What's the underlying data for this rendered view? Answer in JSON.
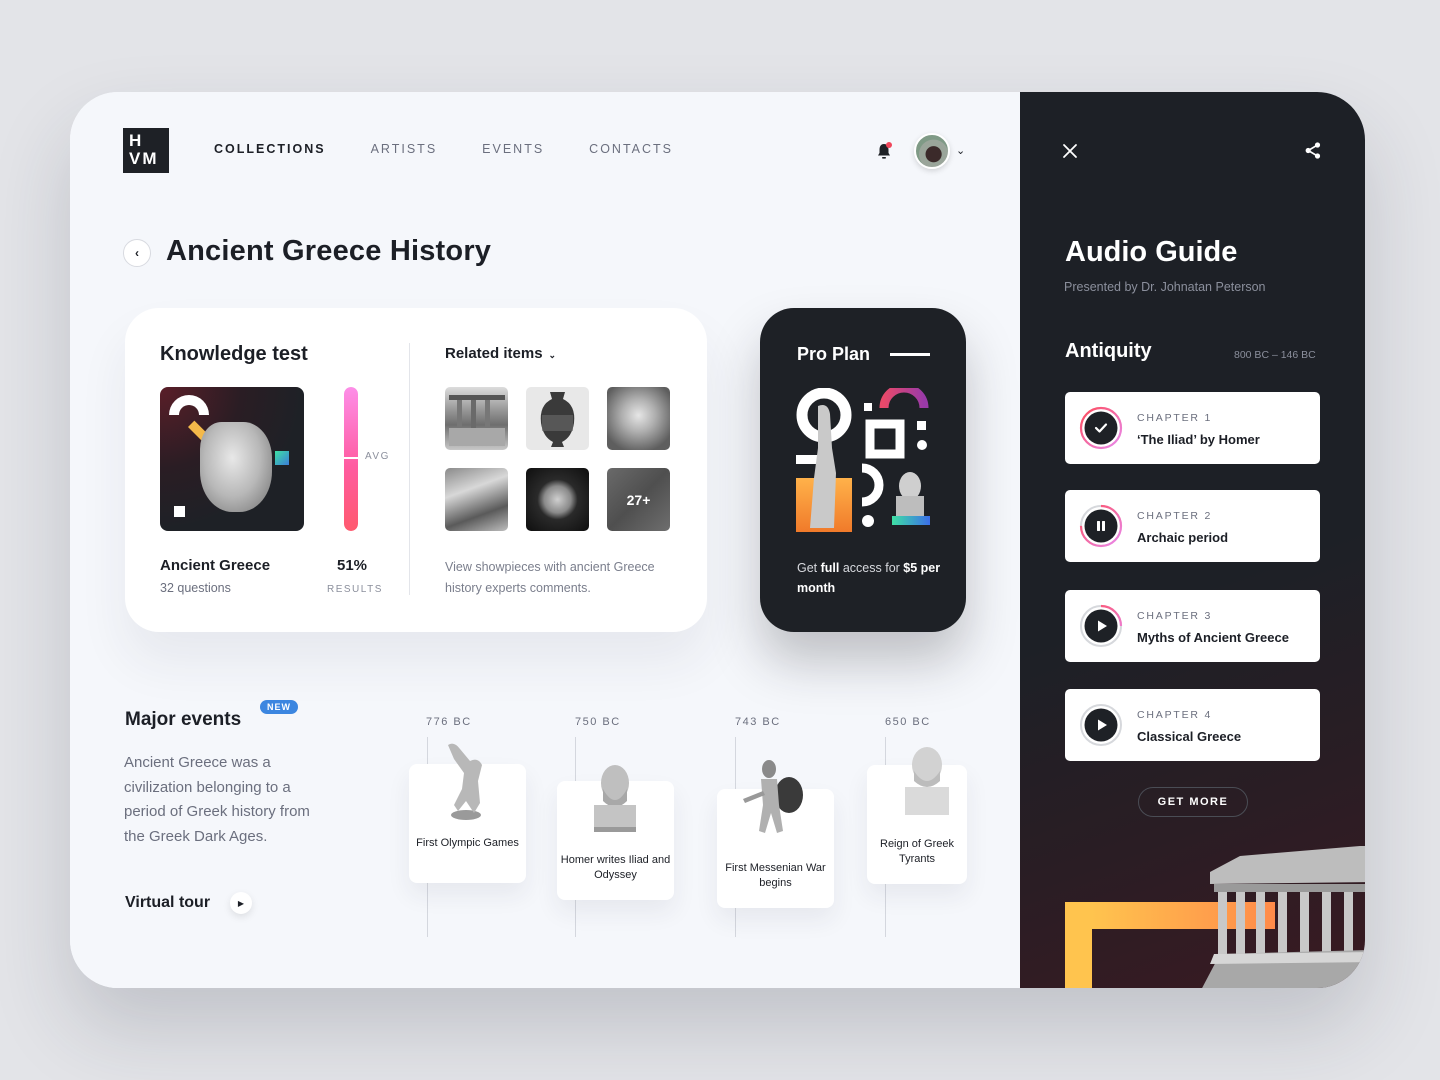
{
  "brand": {
    "logo_line1": "H",
    "logo_line2": "VM"
  },
  "nav": {
    "items": [
      {
        "label": "COLLECTIONS",
        "active": true
      },
      {
        "label": "ARTISTS",
        "active": false
      },
      {
        "label": "EVENTS",
        "active": false
      },
      {
        "label": "CONTACTS",
        "active": false
      }
    ],
    "notifications_unread": true,
    "user_menu_icon": "chevron-down-icon"
  },
  "page": {
    "back_icon": "chevron-left-icon",
    "title": "Ancient Greece History"
  },
  "knowledge_test": {
    "title": "Knowledge test",
    "name": "Ancient Greece",
    "questions": "32 questions",
    "result": "51%",
    "result_label": "RESULTS",
    "avg_label": "AVG",
    "progress_fraction": 1.0,
    "avg_fraction": 0.51
  },
  "related": {
    "title": "Related items",
    "thumbnails": [
      {
        "name": "caryatids"
      },
      {
        "name": "amphora-vase"
      },
      {
        "name": "laocoon-sculpture"
      },
      {
        "name": "painting-scene"
      },
      {
        "name": "golden-mask"
      },
      {
        "name": "fresco",
        "overlay": "27+"
      }
    ],
    "description": "View showpieces with ancient Greece history experts comments."
  },
  "pro_plan": {
    "title": "Pro Plan",
    "text_pre": "Get ",
    "text_bold1": "full",
    "text_mid": " access for ",
    "text_bold2": "$5 per month"
  },
  "major_events": {
    "title": "Major events",
    "badge": "NEW",
    "description": "Ancient Greece was a civilization belonging to a period of Greek history from the Greek Dark Ages.",
    "virtual_tour": "Virtual tour",
    "timeline": [
      {
        "year": "776 BC",
        "caption": "First Olympic Games"
      },
      {
        "year": "750 BC",
        "caption": "Homer writes Iliad and Odyssey"
      },
      {
        "year": "743 BC",
        "caption": "First Messenian War begins"
      },
      {
        "year": "650 BC",
        "caption": "Reign of Greek Tyrants"
      }
    ]
  },
  "audio_guide": {
    "title": "Audio Guide",
    "presenter": "Presented by Dr. Johnatan Peterson",
    "section_title": "Antiquity",
    "section_range": "800 BC – 146 BC",
    "chapters": [
      {
        "label": "CHAPTER 1",
        "title": "‘The Iliad’ by Homer",
        "state": "completed",
        "progress": 1.0
      },
      {
        "label": "CHAPTER 2",
        "title": "Archaic period",
        "state": "playing",
        "progress": 0.75
      },
      {
        "label": "CHAPTER 3",
        "title": "Myths of Ancient Greece",
        "state": "paused",
        "progress": 0.25
      },
      {
        "label": "CHAPTER 4",
        "title": "Classical Greece",
        "state": "not-started",
        "progress": 0.0
      }
    ],
    "get_more": "GET MORE"
  },
  "colors": {
    "accent_pink": "#ff5ba0",
    "accent_red": "#ff4a5a",
    "badge_blue": "#3c86e0",
    "dark": "#1e2126",
    "bell_dot": "#f0455a"
  }
}
